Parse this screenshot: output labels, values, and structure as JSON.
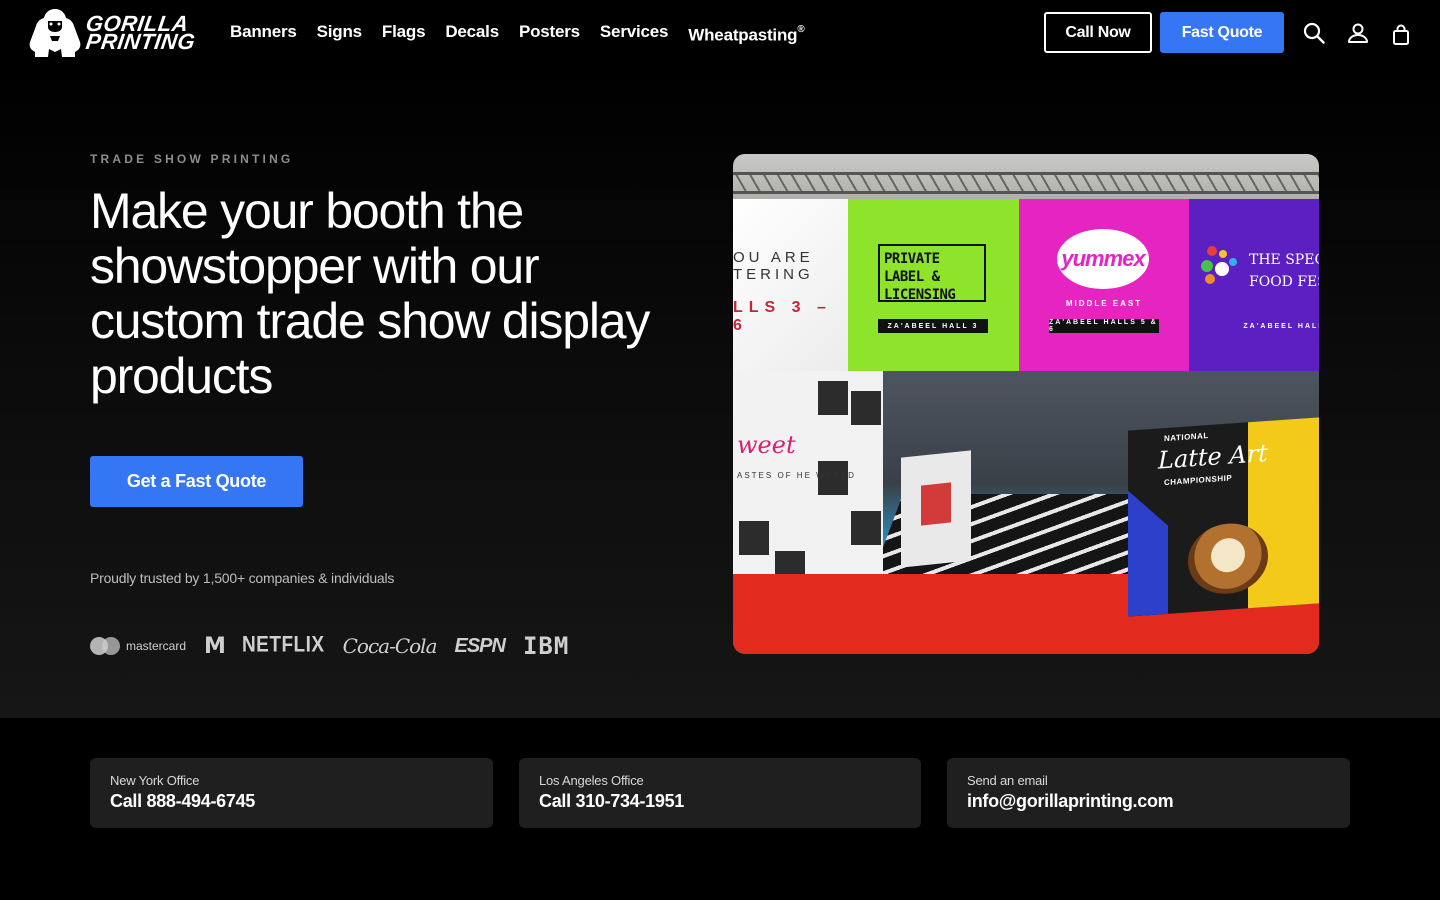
{
  "header": {
    "logo": {
      "line1": "GORILLA",
      "line2": "PRINTING",
      "icon": "gorilla-logo-icon"
    },
    "nav": [
      {
        "label": "Banners"
      },
      {
        "label": "Signs"
      },
      {
        "label": "Flags"
      },
      {
        "label": "Decals"
      },
      {
        "label": "Posters"
      },
      {
        "label": "Services"
      },
      {
        "label": "Wheatpasting",
        "sup": "®"
      }
    ],
    "call_button": "Call Now",
    "quote_button": "Fast Quote",
    "icons": [
      "search-icon",
      "account-icon",
      "shopping-bag-icon"
    ]
  },
  "hero": {
    "eyebrow": "TRADE SHOW PRINTING",
    "headline": "Make your booth the showstopper with our custom trade show display products",
    "cta": "Get a Fast Quote",
    "trusted": "Proudly trusted by 1,500+ companies & individuals",
    "brand_logos": {
      "mastercard": "mastercard",
      "mtv": "M",
      "netflix": "NETFLIX",
      "coca_cola": "Coca-Cola",
      "espn": "ESPN",
      "ibm": "IBM"
    },
    "photo": {
      "panel1_line1": "OU ARE",
      "panel1_line2": "TERING",
      "panel1_halls": "LLS 3 – 6",
      "panel2_title": "PRIVATE LABEL & LICENSING",
      "panel2_tag": "ZA'ABEEL HALL 3",
      "panel3_brand": "yummex",
      "panel3_sub": "MIDDLE EAST",
      "panel3_tag": "ZA'ABEEL HALLS 5 & 6",
      "panel4_title1": "THE SPECI",
      "panel4_title2": "FOOD FEST",
      "panel4_tag": "ZA'ABEEL HALL",
      "left_script": "weet",
      "left_small": "ASTES OF HE WORLD",
      "latte_title": "Latte Art",
      "latte_sub": "CHAMPIONSHIP",
      "latte_top": "NATIONAL"
    }
  },
  "contacts": [
    {
      "label": "New York Office",
      "value": "Call 888-494-6745"
    },
    {
      "label": "Los Angeles Office",
      "value": "Call 310-734-1951"
    },
    {
      "label": "Send an email",
      "value": "info@gorillaprinting.com"
    }
  ],
  "colors": {
    "accent": "#3476f4",
    "background": "#000000",
    "card": "#1f1f1f"
  }
}
